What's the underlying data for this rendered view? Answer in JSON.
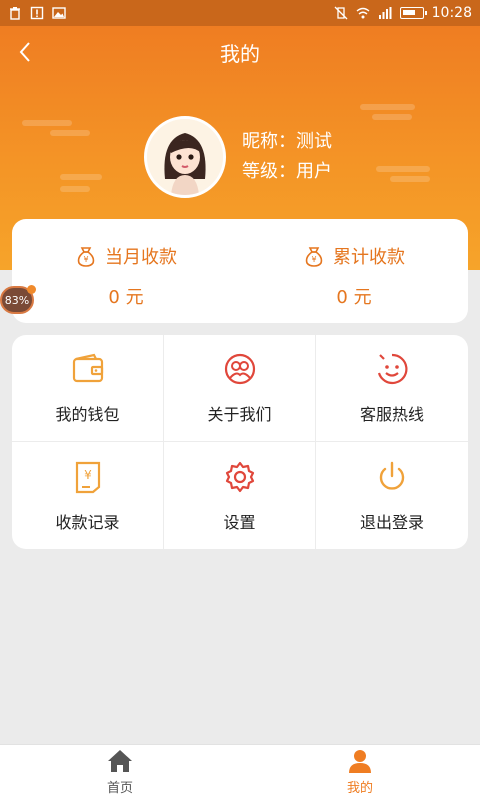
{
  "status_bar": {
    "time": "10:28",
    "battery_level": 0.7
  },
  "header": {
    "title": "我的"
  },
  "profile": {
    "nickname_text": "昵称：测试",
    "level_text": "等级：用户"
  },
  "stats": [
    {
      "label": "当月收款",
      "value": "0 元",
      "icon": "money-bag-icon"
    },
    {
      "label": "累计收款",
      "value": "0 元",
      "icon": "money-bag-icon"
    }
  ],
  "float_bubble": {
    "text": "83%"
  },
  "menu": [
    {
      "label": "我的钱包",
      "icon": "wallet-icon",
      "color": "#f0a23a"
    },
    {
      "label": "关于我们",
      "icon": "about-icon",
      "color": "#e0473b"
    },
    {
      "label": "客服热线",
      "icon": "service-icon",
      "color": "#e0473b"
    },
    {
      "label": "收款记录",
      "icon": "receipt-icon",
      "color": "#f0a23a"
    },
    {
      "label": "设置",
      "icon": "settings-icon",
      "color": "#e0473b"
    },
    {
      "label": "退出登录",
      "icon": "power-icon",
      "color": "#f0a23a"
    }
  ],
  "tabs": [
    {
      "label": "首页",
      "icon": "home-icon",
      "active": false
    },
    {
      "label": "我的",
      "icon": "user-icon",
      "active": true
    }
  ],
  "colors": {
    "accent": "#ef7d22",
    "status_bar": "#c9671b"
  }
}
